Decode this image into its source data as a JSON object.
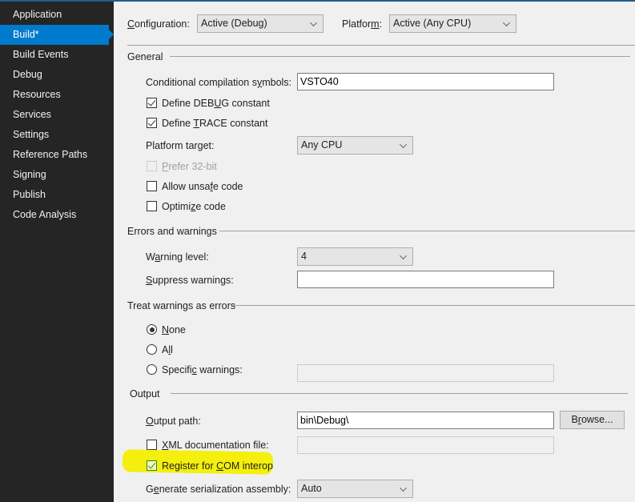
{
  "sidebar": {
    "items": [
      {
        "label": "Application",
        "active": false
      },
      {
        "label": "Build*",
        "active": true
      },
      {
        "label": "Build Events",
        "active": false
      },
      {
        "label": "Debug",
        "active": false
      },
      {
        "label": "Resources",
        "active": false
      },
      {
        "label": "Services",
        "active": false
      },
      {
        "label": "Settings",
        "active": false
      },
      {
        "label": "Reference Paths",
        "active": false
      },
      {
        "label": "Signing",
        "active": false
      },
      {
        "label": "Publish",
        "active": false
      },
      {
        "label": "Code Analysis",
        "active": false
      }
    ]
  },
  "header": {
    "configuration_label_u": "C",
    "configuration_label_rest": "onfiguration:",
    "configuration_value": "Active (Debug)",
    "platform_label_pre": "Platfor",
    "platform_label_u": "m",
    "platform_label_post": ":",
    "platform_value": "Active (Any CPU)"
  },
  "general": {
    "title": "General",
    "symbols_label_pre": "Conditional compilation s",
    "symbols_label_u": "y",
    "symbols_label_post": "mbols:",
    "symbols_value": "VSTO40",
    "define_debug_pre": "Define DEB",
    "define_debug_u": "U",
    "define_debug_post": "G constant",
    "define_debug_checked": true,
    "define_trace_pre": "Define ",
    "define_trace_u": "T",
    "define_trace_post": "RACE constant",
    "define_trace_checked": true,
    "platform_target_pre": "Platform tar",
    "platform_target_u": "g",
    "platform_target_post": "et:",
    "platform_target_value": "Any CPU",
    "prefer32_u": "P",
    "prefer32_rest": "refer 32-bit",
    "prefer32_checked": false,
    "unsafe_pre": "Allow unsa",
    "unsafe_u": "f",
    "unsafe_post": "e code",
    "unsafe_checked": false,
    "optimize_pre": "Optimi",
    "optimize_u": "z",
    "optimize_post": "e code",
    "optimize_checked": false
  },
  "errors": {
    "title": "Errors and warnings",
    "warning_level_pre": "W",
    "warning_level_u": "a",
    "warning_level_post": "rning level:",
    "warning_level_value": "4",
    "suppress_u": "S",
    "suppress_rest": "uppress warnings:",
    "suppress_value": ""
  },
  "treat": {
    "title": "Treat warnings as errors",
    "none_u": "N",
    "none_rest": "one",
    "all_pre": "A",
    "all_u": "l",
    "all_post": "l",
    "specific_pre": "Specifi",
    "specific_u": "c",
    "specific_post": " warnings:",
    "selected": "None",
    "specific_value": ""
  },
  "output": {
    "title": "Output",
    "path_u": "O",
    "path_rest": "utput path:",
    "path_value": "bin\\Debug\\",
    "browse_pre": "B",
    "browse_u": "r",
    "browse_post": "owse...",
    "xml_u": "X",
    "xml_rest": "ML documentation file:",
    "xml_checked": false,
    "xml_value": "",
    "com_pre": "Register for ",
    "com_u": "C",
    "com_post": "OM interop",
    "com_checked": true,
    "serial_pre": "G",
    "serial_u": "e",
    "serial_post": "nerate serialization assembly:",
    "serial_value": "Auto"
  },
  "colors": {
    "sidebar_bg": "#252526",
    "accent": "#007acc",
    "highlight": "#f3ee00",
    "panel_bg": "#f0f0f0"
  }
}
